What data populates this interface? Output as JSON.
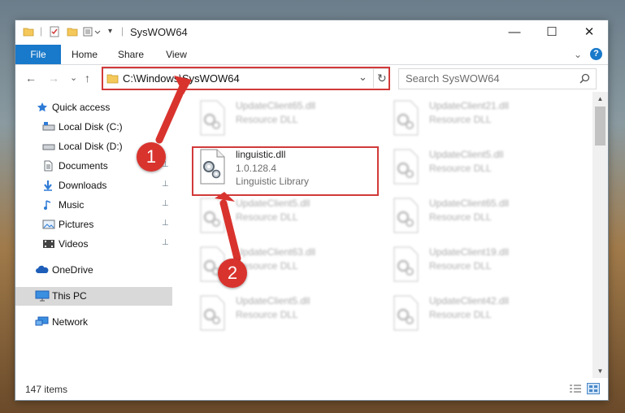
{
  "window": {
    "title": "SysWOW64",
    "minimize_glyph": "—",
    "maximize_glyph": "☐",
    "close_glyph": "✕"
  },
  "ribbon": {
    "tabs": [
      {
        "label": "File"
      },
      {
        "label": "Home"
      },
      {
        "label": "Share"
      },
      {
        "label": "View"
      }
    ],
    "expand_glyph": "⌄",
    "help_glyph": "?"
  },
  "address": {
    "path": "C:\\Windows\\SysWOW64",
    "dropdown_glyph": "⌄",
    "refresh_glyph": "↻"
  },
  "search": {
    "placeholder": "Search SysWOW64"
  },
  "nav": {
    "back_glyph": "←",
    "forward_glyph": "→",
    "recent_glyph": "⌄",
    "up_glyph": "↑",
    "items": [
      {
        "label": "Quick access",
        "icon": "star-icon"
      },
      {
        "label": "Local Disk (C:)",
        "icon": "drive-icon"
      },
      {
        "label": "Local Disk (D:)",
        "icon": "drive-icon"
      },
      {
        "label": "Documents",
        "icon": "documents-icon"
      },
      {
        "label": "Downloads",
        "icon": "downloads-icon"
      },
      {
        "label": "Music",
        "icon": "music-icon"
      },
      {
        "label": "Pictures",
        "icon": "pictures-icon"
      },
      {
        "label": "Videos",
        "icon": "videos-icon"
      },
      {
        "label": "OneDrive",
        "icon": "cloud-icon"
      },
      {
        "label": "This PC",
        "icon": "computer-icon"
      },
      {
        "label": "Network",
        "icon": "network-icon"
      }
    ],
    "pin_glyph": "📌"
  },
  "files": [
    {
      "name": "UpdateClient65.dll",
      "type": "Resource DLL"
    },
    {
      "name": "UpdateClient21.dll",
      "type": "Resource DLL"
    },
    {
      "name": "linguistic.dll",
      "version": "1.0.128.4",
      "type": "Linguistic Library"
    },
    {
      "name": "UpdateClient5.dll",
      "type": "Resource DLL"
    },
    {
      "name": "UpdateClient5.dll",
      "type": "Resource DLL"
    },
    {
      "name": "UpdateClient65.dll",
      "type": "Resource DLL"
    },
    {
      "name": "UpdateClient63.dll",
      "type": "Resource DLL"
    },
    {
      "name": "UpdateClient19.dll",
      "type": "Resource DLL"
    },
    {
      "name": "UpdateClient5.dll",
      "type": "Resource DLL"
    },
    {
      "name": "UpdateClient42.dll",
      "type": "Resource DLL"
    }
  ],
  "status": {
    "item_count": "147 items"
  },
  "annotations": {
    "step1": "1",
    "step2": "2",
    "highlight_color": "#d23a3a"
  },
  "colors": {
    "accent": "#1979ca",
    "selection": "#d9d9d9"
  }
}
